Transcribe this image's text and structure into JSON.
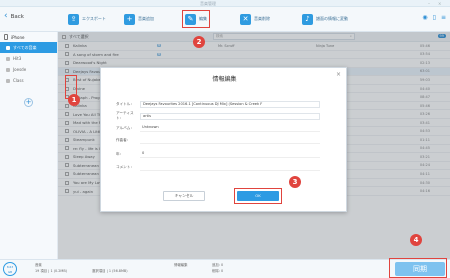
{
  "window": {
    "title": "音楽管理"
  },
  "toolbar": {
    "back_label": "Back",
    "export_label": "エクスポート",
    "add_label": "音楽追加",
    "edit_label": "編集",
    "delete_label": "音楽削除",
    "fix_label": "譜面の情報に変動"
  },
  "sidebar": {
    "device_label": "iPhone",
    "items": [
      {
        "label": "すべての音楽"
      },
      {
        "label": "Hit3"
      },
      {
        "label": "Joesde"
      },
      {
        "label": "Class"
      }
    ]
  },
  "list": {
    "select_all_label": "すべて選択",
    "search_placeholder": "検索",
    "count": "99",
    "rows": [
      {
        "name": "Kalinka",
        "tag": "M",
        "artist": "Mr. Scruff",
        "album": "Ninja Tune",
        "duration": "05:46"
      },
      {
        "name": "A song of storm and fire",
        "tag": "M",
        "artist": "",
        "album": "",
        "duration": "03:54"
      },
      {
        "name": "Dearwood's Night",
        "tag": "",
        "artist": "",
        "album": "",
        "duration": "02:13"
      },
      {
        "name": "Deejays Favourite",
        "tag": "M",
        "artist": "",
        "album": "",
        "duration": "63:01"
      },
      {
        "name": "Best of Nujabes",
        "tag": "",
        "artist": "",
        "album": "",
        "duration": "59:03"
      },
      {
        "name": "Divine",
        "tag": "M",
        "artist": "",
        "album": "",
        "duration": "04:40"
      },
      {
        "name": "Epitaph - Progra",
        "tag": "",
        "artist": "",
        "album": "",
        "duration": "08:47"
      },
      {
        "name": "Kalinka",
        "tag": "M",
        "artist": "",
        "album": "",
        "duration": "05:46"
      },
      {
        "name": "Love You All The",
        "tag": "",
        "artist": "",
        "album": "",
        "duration": "03:26"
      },
      {
        "name": "Mad with the Fir",
        "tag": "",
        "artist": "",
        "album": "...ntic, Vol. 1",
        "duration": "03:41"
      },
      {
        "name": "OLIVIA - A Little",
        "tag": "",
        "artist": "",
        "album": "",
        "duration": "04:53"
      },
      {
        "name": "Steampunk",
        "tag": "",
        "artist": "",
        "album": "",
        "duration": "01:11"
      },
      {
        "name": "re: fly - life is like",
        "tag": "",
        "artist": "",
        "album": "",
        "duration": "04:45"
      },
      {
        "name": "Sleep Away",
        "tag": "M",
        "artist": "",
        "album": "",
        "duration": "03:21"
      },
      {
        "name": "Subterranean Animism Character Song (R)",
        "tag": "M",
        "artist": "",
        "album": "",
        "duration": "04:24"
      },
      {
        "name": "Subterranean Animism Character Song (R)",
        "tag": "M",
        "artist": "",
        "album": "",
        "duration": "04:11"
      },
      {
        "name": "You are My Love",
        "tag": "",
        "artist": "",
        "album": "",
        "duration": "04:30"
      },
      {
        "name": "yui - again",
        "tag": "M",
        "artist": "",
        "album": "",
        "duration": "04:16"
      }
    ]
  },
  "dialog": {
    "title": "情報編集",
    "close_glyph": "×",
    "fields": [
      {
        "label": "タイトル：",
        "value": "Deejays Favourites 2016.1 [Continuous DJ Mix] (Session & Creek F"
      },
      {
        "label": "アーティスト：",
        "value": "artis"
      },
      {
        "label": "アルバム：",
        "value": "Unknown"
      },
      {
        "label": "作曲者：",
        "value": ""
      },
      {
        "label": "年：",
        "value": "0"
      },
      {
        "label": "コメント：",
        "value": ""
      }
    ],
    "cancel_label": "キャンセル",
    "ok_label": "OK"
  },
  "footer": {
    "storage_value": "8.63",
    "storage_unit": "GB",
    "music_label": "音楽",
    "music_stats": "19 項目 | 1 (0.2MB)",
    "selected_label": "選択項目 | 1 (56.8MB)",
    "sync_label": "同期",
    "stat_a": "情報編集",
    "stat_b": "追加: 0",
    "stat_c": "削除: 0"
  },
  "annotations": [
    "1",
    "2",
    "3",
    "4"
  ],
  "colors": {
    "accent": "#2d9be3",
    "highlight": "#e0443e",
    "toolbar_bg": "#f4f8fb"
  }
}
